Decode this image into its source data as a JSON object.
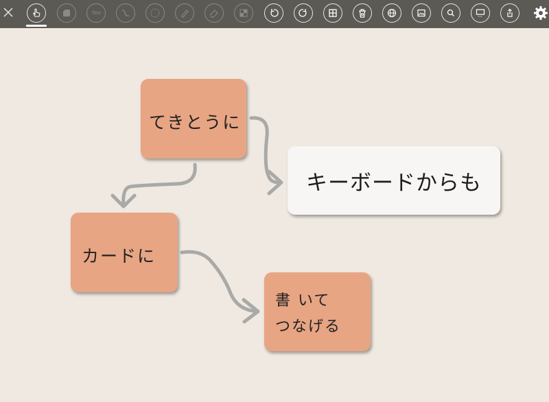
{
  "toolbar": {
    "tools": [
      {
        "name": "close-icon"
      },
      {
        "name": "hand-pointer-icon",
        "active": true
      },
      {
        "name": "card-stack-icon"
      },
      {
        "name": "text-tool",
        "label": "Text"
      },
      {
        "name": "curve-connector-icon"
      },
      {
        "name": "lasso-select-icon"
      },
      {
        "name": "pen-icon"
      },
      {
        "name": "eraser-icon"
      },
      {
        "name": "image-grid-icon"
      },
      {
        "name": "undo-icon"
      },
      {
        "name": "redo-icon"
      },
      {
        "name": "grid-icon"
      },
      {
        "name": "trash-icon"
      },
      {
        "name": "globe-icon"
      },
      {
        "name": "photo-icon"
      },
      {
        "name": "search-icon"
      },
      {
        "name": "presentation-icon"
      },
      {
        "name": "share-icon"
      },
      {
        "name": "gear-icon"
      }
    ]
  },
  "cards": [
    {
      "id": "card-tekitouni",
      "text": "てきとうに",
      "style": "handwritten",
      "color": "#e7a584"
    },
    {
      "id": "card-keyboard",
      "text": "キーボードからも",
      "style": "typed",
      "color": "#f7f6f5"
    },
    {
      "id": "card-cardoni",
      "text": "カードに",
      "style": "handwritten",
      "color": "#e7a584"
    },
    {
      "id": "card-kaite",
      "line1": "書 いて",
      "line2": "つなげる",
      "style": "handwritten",
      "color": "#e7a584"
    }
  ],
  "colors": {
    "toolbar_bg": "#5b5a55",
    "canvas_bg": "#efe9e1",
    "connector": "#a9a9a7"
  }
}
